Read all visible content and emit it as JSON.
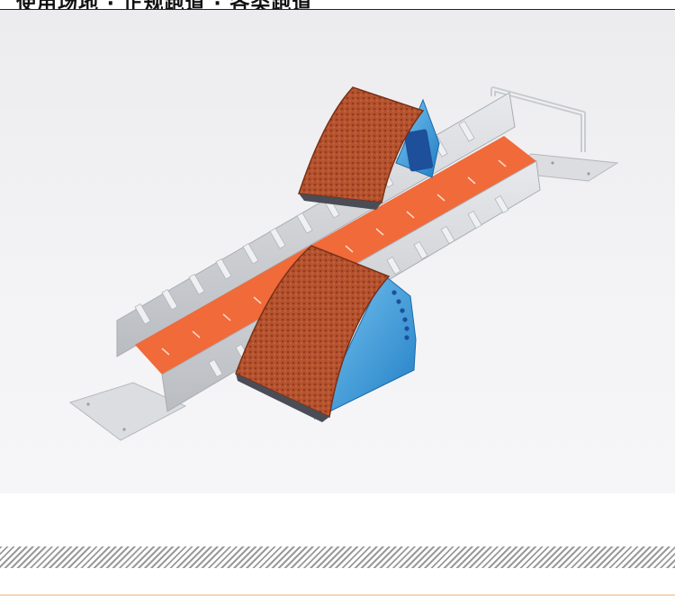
{
  "banner": {
    "text": "使用场地 · 正规跑道 · 各类跑道"
  },
  "photo": {
    "subject": "starting-block",
    "colors": {
      "pad_red": "#b5532f",
      "pad_dark": "#8e3a1f",
      "frame_aluminum": "#d7d9dc",
      "rail_orange": "#f06a3a",
      "blue_side": "#3aa0e0"
    }
  },
  "divider": {
    "style": "diagonal-stripes"
  }
}
